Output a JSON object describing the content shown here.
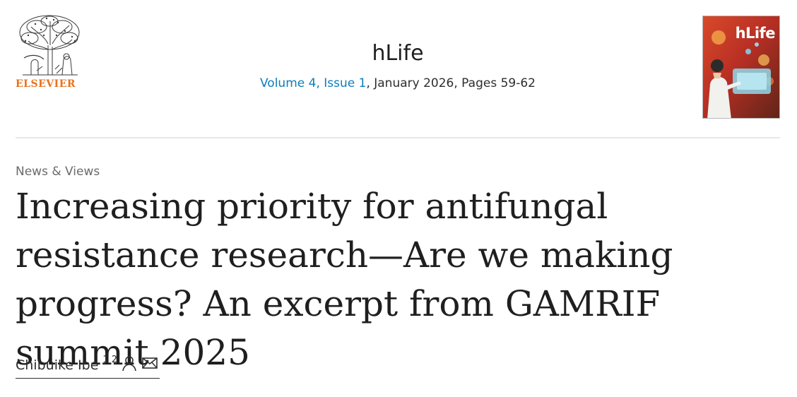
{
  "header": {
    "publisher_name": "ELSEVIER",
    "journal_title": "hLife",
    "issue": {
      "volume_link": "Volume 4, Issue 1",
      "date_pages": ", January 2026, Pages 59-62"
    },
    "cover_title": "hLife"
  },
  "article": {
    "type": "News & Views",
    "title": "Increasing priority for antifungal resistance research—Are we making progress? An excerpt from GAMRIF summit 2025"
  },
  "author": {
    "name": "Chibuike Ibe",
    "affiliations": "1 2",
    "icons": [
      "person-icon",
      "envelope-icon"
    ]
  },
  "colors": {
    "publisher_orange": "#e9711c",
    "link_blue": "#0c7dbb",
    "text": "#1f1f1f",
    "muted": "#6b6b6b"
  }
}
